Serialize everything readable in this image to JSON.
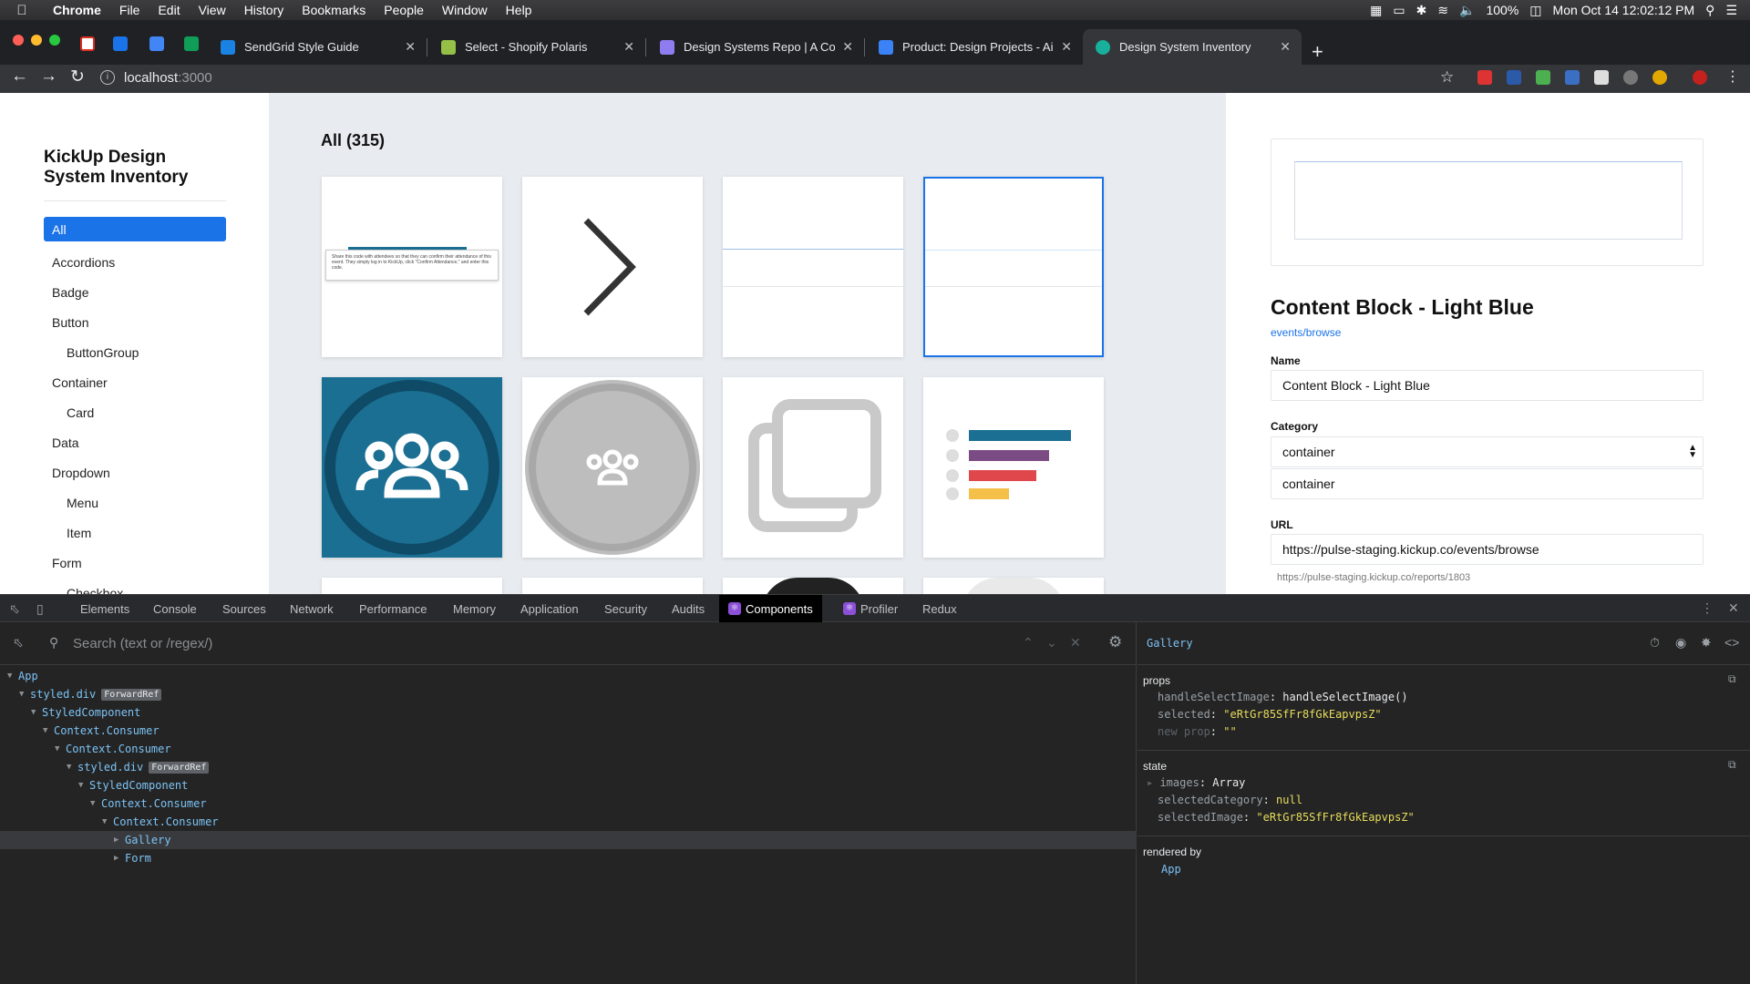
{
  "menubar": {
    "app": "Chrome",
    "items": [
      "File",
      "Edit",
      "View",
      "History",
      "Bookmarks",
      "People",
      "Window",
      "Help"
    ],
    "battery": "100%",
    "clock": "Mon Oct 14  12:02:12 PM"
  },
  "tabs": [
    {
      "title": "SendGrid Style Guide",
      "icon_color": "#1a82e2"
    },
    {
      "title": "Select - Shopify Polaris",
      "icon_color": "#95bf47"
    },
    {
      "title": "Design Systems Repo | A Colle",
      "icon_color": "#8f7df0"
    },
    {
      "title": "Product: Design Projects - Airt",
      "icon_color": "#3b82f6"
    },
    {
      "title": "Design System Inventory",
      "icon_color": "#18b09a"
    }
  ],
  "address": {
    "host": "localhost",
    "port": ":3000"
  },
  "sidebar": {
    "brand": "KickUp Design System Inventory",
    "items": [
      {
        "label": "All",
        "active": true,
        "sub": false
      },
      {
        "label": "Accordions",
        "sub": false
      },
      {
        "label": "Badge",
        "sub": false
      },
      {
        "label": "Button",
        "sub": false
      },
      {
        "label": "ButtonGroup",
        "sub": true
      },
      {
        "label": "Container",
        "sub": false
      },
      {
        "label": "Card",
        "sub": true
      },
      {
        "label": "Data",
        "sub": false
      },
      {
        "label": "Dropdown",
        "sub": false
      },
      {
        "label": "Menu",
        "sub": true
      },
      {
        "label": "Item",
        "sub": true
      },
      {
        "label": "Form",
        "sub": false
      },
      {
        "label": "Checkbox",
        "sub": true
      }
    ]
  },
  "gallery": {
    "heading": "All (315)",
    "tile1_text": "Share this code with attendees so that they can confirm their attendance of this event. They simply log in to KickUp, click \"Confirm Attendance,\" and enter this code.",
    "colors": {
      "teal": "#1a6f93",
      "teal_dark": "#0f4a66",
      "bar1": "#1a6f93",
      "bar2": "#7b4c83",
      "bar3": "#e0474c",
      "bar4": "#f5c04a"
    }
  },
  "detail": {
    "title": "Content Block - Light Blue",
    "path": "events/browse",
    "name_label": "Name",
    "name_value": "Content Block - Light Blue",
    "category_label": "Category",
    "category_select": "container",
    "category_value": "container",
    "url_label": "URL",
    "url_value": "https://pulse-staging.kickup.co/events/browse",
    "url_hint": "https://pulse-staging.kickup.co/reports/1803"
  },
  "devtools": {
    "tabs": [
      "Elements",
      "Console",
      "Sources",
      "Network",
      "Performance",
      "Memory",
      "Application",
      "Security",
      "Audits",
      "Components",
      "Profiler",
      "Redux"
    ],
    "active_tab": "Components",
    "search_placeholder": "Search (text or /regex/)",
    "tree": [
      {
        "label": "App",
        "depth": 0
      },
      {
        "label": "styled.div",
        "depth": 1,
        "badge": "ForwardRef"
      },
      {
        "label": "StyledComponent",
        "depth": 2
      },
      {
        "label": "Context.Consumer",
        "depth": 3
      },
      {
        "label": "Context.Consumer",
        "depth": 4
      },
      {
        "label": "styled.div",
        "depth": 5,
        "badge": "ForwardRef"
      },
      {
        "label": "StyledComponent",
        "depth": 6
      },
      {
        "label": "Context.Consumer",
        "depth": 7
      },
      {
        "label": "Context.Consumer",
        "depth": 8
      },
      {
        "label": "Gallery",
        "depth": 9,
        "selected": true,
        "collapsed": true
      },
      {
        "label": "Form",
        "depth": 9,
        "collapsed": true
      }
    ],
    "selected_component": "Gallery",
    "props_title": "props",
    "props": {
      "handleSelectImage_key": "handleSelectImage",
      "handleSelectImage_val": "handleSelectImage()",
      "selected_key": "selected",
      "selected_val": "\"eRtGr85SfFr8fGkEapvpsZ\"",
      "new_prop_key": "new prop",
      "new_prop_val": "\"\""
    },
    "state_title": "state",
    "state": {
      "images_key": "images",
      "images_val": "Array",
      "selectedCategory_key": "selectedCategory",
      "selectedCategory_val": "null",
      "selectedImage_key": "selectedImage",
      "selectedImage_val": "\"eRtGr85SfFr8fGkEapvpsZ\""
    },
    "rendered_by_title": "rendered by",
    "rendered_by": "App"
  }
}
